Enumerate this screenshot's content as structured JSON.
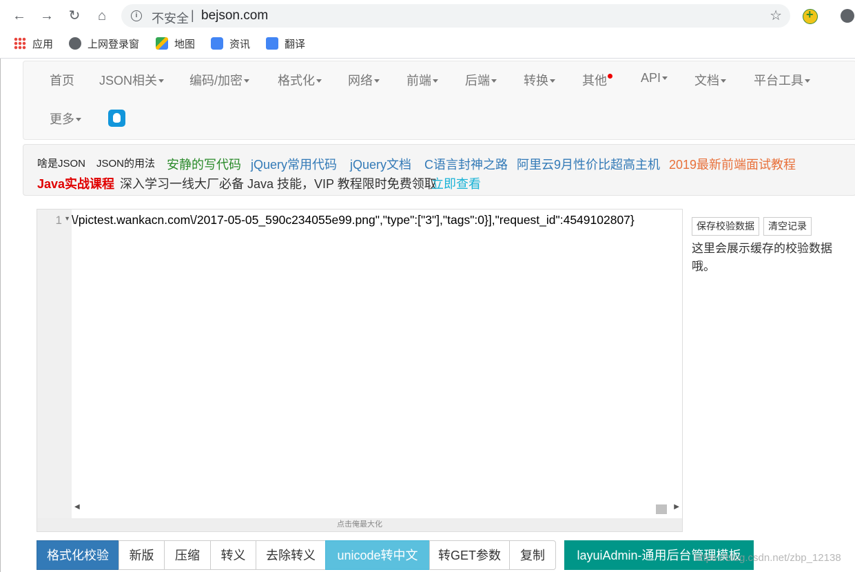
{
  "browser": {
    "insecure_label": "不安全",
    "separator": "|",
    "url": "bejson.com",
    "bookmarks": [
      "应用",
      "上网登录窗",
      "地图",
      "资讯",
      "翻译"
    ]
  },
  "nav": {
    "items": [
      "首页",
      "JSON相关",
      "编码/加密",
      "格式化",
      "网络",
      "前端",
      "后端",
      "转换",
      "其他",
      "API",
      "文档",
      "平台工具"
    ],
    "more": "更多"
  },
  "links": {
    "row1": [
      "啥是JSON",
      "JSON的用法",
      "安静的写代码",
      "jQuery常用代码",
      "jQuery文档",
      "C语言封神之路",
      "阿里云9月性价比超高主机",
      "2019最新前端面试教程"
    ],
    "java_course": "Java实战课程",
    "java_desc": "深入学习一线大厂必备 Java 技能，VIP 教程限时免费领取",
    "java_link": "立即查看",
    "colors": {
      "green": "#2a8a2a",
      "blue": "#337ab7",
      "orange": "#e8703a",
      "red": "#e00000",
      "cyan": "#1ab3d6"
    }
  },
  "editor": {
    "line_number": "1",
    "code": "\\/pictest.wankacn.com\\/2017-05-05_590c234055e99.png\",\"type\":[\"3\"],\"tags\":0}],\"request_id\":4549102807}",
    "maximize_hint": "点击俺最大化"
  },
  "side": {
    "save_label": "保存校验数据",
    "clear_label": "清空记录",
    "cache_text": "这里会展示缓存的校验数据哦。"
  },
  "actions": [
    "格式化校验",
    "新版",
    "压缩",
    "转义",
    "去除转义",
    "unicode转中文",
    "转GET参数",
    "复制",
    "layuiAdmin-通用后台管理模板"
  ],
  "watermark": "https://blog.csdn.net/zbp_12138"
}
